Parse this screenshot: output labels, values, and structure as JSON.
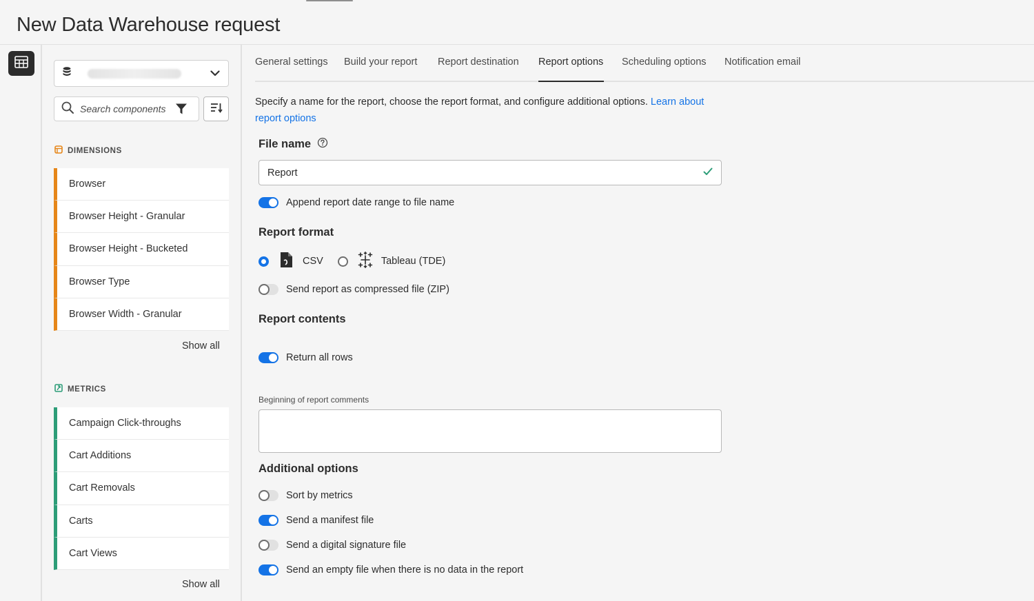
{
  "page": {
    "title": "New Data Warehouse request"
  },
  "panel": {
    "search_placeholder": "Search components",
    "dimensions": {
      "label": "DIMENSIONS",
      "items": [
        "Browser",
        "Browser Height - Granular",
        "Browser Height - Bucketed",
        "Browser Type",
        "Browser Width - Granular"
      ],
      "show_all": "Show all"
    },
    "metrics": {
      "label": "METRICS",
      "items": [
        "Campaign Click-throughs",
        "Cart Additions",
        "Cart Removals",
        "Carts",
        "Cart Views"
      ],
      "show_all": "Show all"
    }
  },
  "tabs": [
    {
      "label": "General settings",
      "active": false
    },
    {
      "label": "Build your report",
      "active": false
    },
    {
      "label": "Report destination",
      "active": false
    },
    {
      "label": "Report options",
      "active": true
    },
    {
      "label": "Scheduling options",
      "active": false
    },
    {
      "label": "Notification email",
      "active": false
    }
  ],
  "content": {
    "intro_text": "Specify a name for the report, choose the report format, and configure additional options. ",
    "intro_link": "Learn about report options",
    "file_name": {
      "label": "File name",
      "value": "Report"
    },
    "append_date_toggle": {
      "label": "Append report date range to file name",
      "on": true
    },
    "report_format": {
      "label": "Report format",
      "options": [
        {
          "label": "CSV",
          "selected": true
        },
        {
          "label": "Tableau (TDE)",
          "selected": false
        }
      ]
    },
    "zip_toggle": {
      "label": "Send report as compressed file (ZIP)",
      "on": false
    },
    "report_contents": {
      "label": "Report contents",
      "return_all_rows": {
        "label": "Return all rows",
        "on": true
      },
      "comments_label": "Beginning of report comments",
      "comments_value": ""
    },
    "additional_options": {
      "label": "Additional options",
      "items": [
        {
          "label": "Sort by metrics",
          "on": false
        },
        {
          "label": "Send a manifest file",
          "on": true
        },
        {
          "label": "Send a digital signature file",
          "on": false
        },
        {
          "label": "Send an empty file when there is no data in the report",
          "on": true
        }
      ]
    }
  },
  "colors": {
    "accent": "#1473e6",
    "dimension_bar": "#e68619",
    "metric_bar": "#2d9d78",
    "valid_check": "#2d9d78"
  }
}
